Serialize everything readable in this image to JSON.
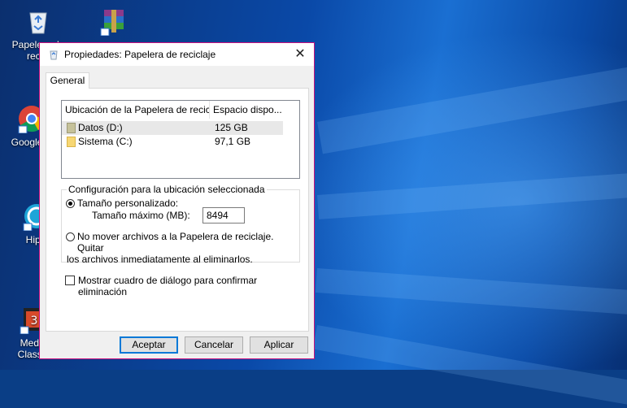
{
  "desktop": {
    "icons": [
      {
        "label": "Papelera de recicl",
        "name": "recycle-bin"
      },
      {
        "label": "WinRAR",
        "name": "winrar"
      },
      {
        "label": "Google C",
        "name": "google-chrome"
      },
      {
        "label": "HipC",
        "name": "hipchat"
      },
      {
        "label": "Media Classic",
        "name": "media-player-classic"
      }
    ]
  },
  "dialog": {
    "title": "Propiedades: Papelera de reciclaje",
    "close_glyph": "✕",
    "tab_label": "General",
    "list": {
      "columns": [
        "Ubicación de la Papelera de reciclaje",
        "Espacio dispo..."
      ],
      "rows": [
        {
          "name": "Datos (D:)",
          "space": "125 GB",
          "selected": true
        },
        {
          "name": "Sistema (C:)",
          "space": "97,1 GB",
          "selected": false
        }
      ]
    },
    "group": {
      "legend": "Configuración para la ubicación seleccionada",
      "custom_size_label": "Tamaño personalizado:",
      "max_size_label": "Tamaño máximo (MB):",
      "max_size_value": "8494",
      "no_move_label_line1": "No mover archivos a la Papelera de reciclaje. Quitar",
      "no_move_label_line2": "los archivos inmediatamente al eliminarlos.",
      "selected_option": "custom"
    },
    "confirm_checkbox_label": "Mostrar cuadro de diálogo para confirmar eliminación",
    "confirm_checked": false,
    "buttons": {
      "ok": "Aceptar",
      "cancel": "Cancelar",
      "apply": "Aplicar"
    }
  },
  "colors": {
    "window_border": "#c8107e",
    "desktop_blue": "#0a4aa6",
    "default_button_border": "#0078d7"
  }
}
